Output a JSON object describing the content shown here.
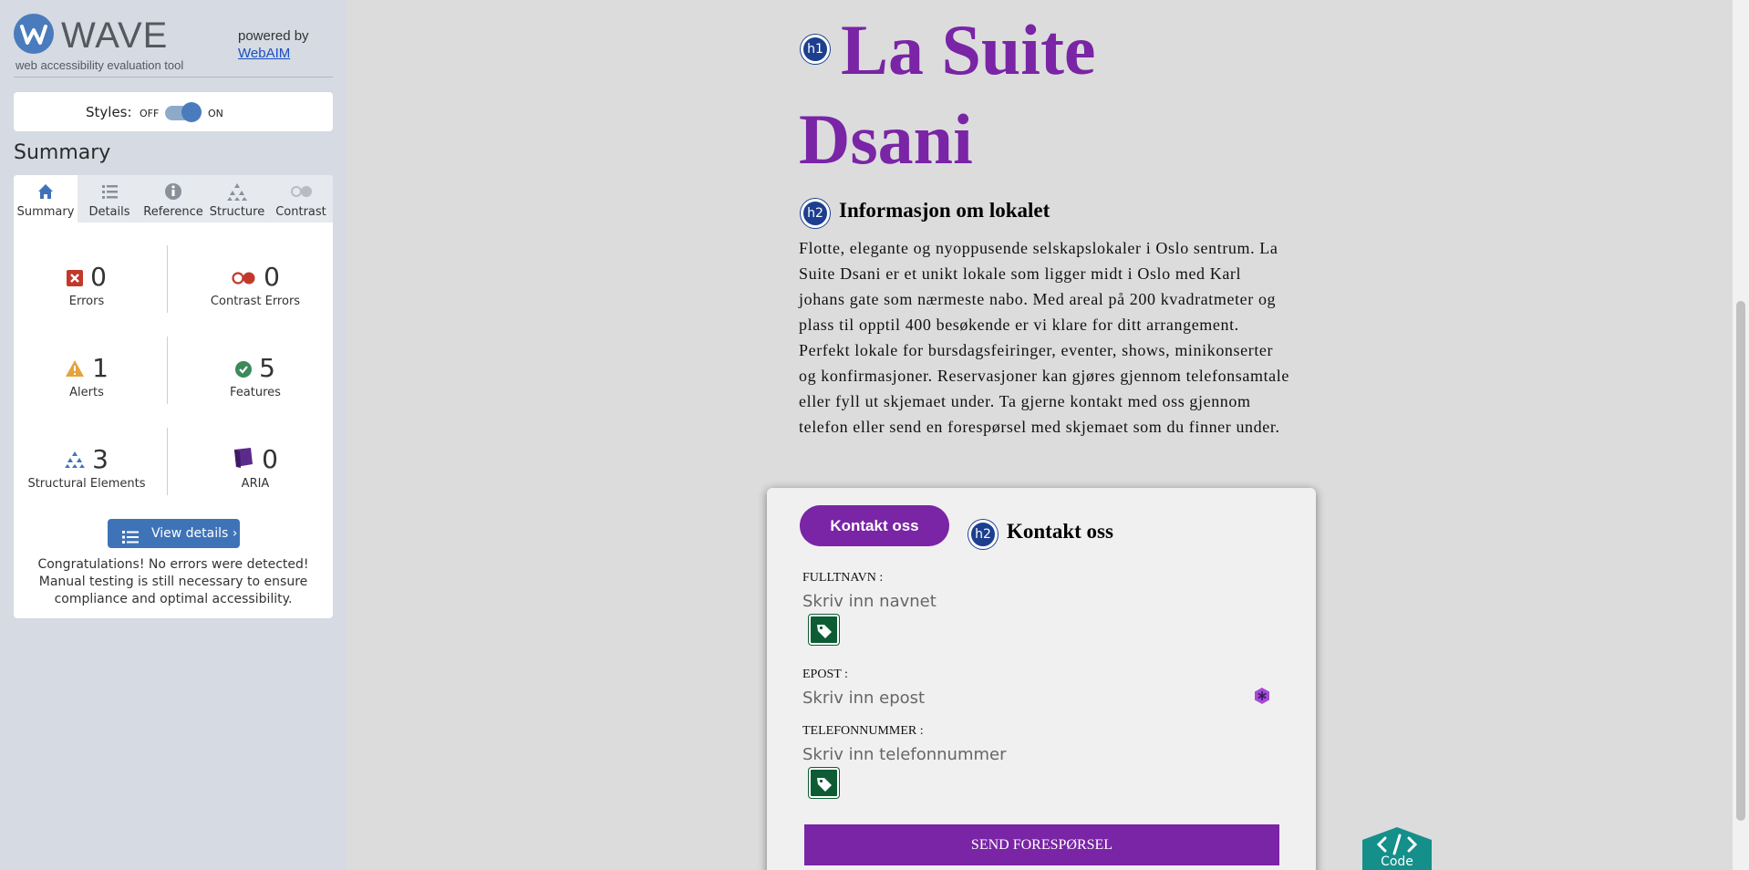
{
  "wave": {
    "brand": "WAVE",
    "tagline": "web accessibility evaluation tool",
    "powered_by": "powered by",
    "webaim_link": "WebAIM",
    "styles_label": "Styles:",
    "toggle_off": "OFF",
    "toggle_on": "ON",
    "summary_title": "Summary",
    "tabs": [
      {
        "label": "Summary",
        "icon": "home-icon",
        "active": true
      },
      {
        "label": "Details",
        "icon": "list-icon",
        "active": false
      },
      {
        "label": "Reference",
        "icon": "info-icon",
        "active": false
      },
      {
        "label": "Structure",
        "icon": "hierarchy-icon",
        "active": false
      },
      {
        "label": "Contrast",
        "icon": "contrast-icon",
        "active": false
      }
    ],
    "stats": {
      "errors": {
        "count": "0",
        "label": "Errors",
        "color": "#c0392b"
      },
      "contrast_errors": {
        "count": "0",
        "label": "Contrast Errors",
        "color": "#c0392b"
      },
      "alerts": {
        "count": "1",
        "label": "Alerts",
        "color": "#e6a23c"
      },
      "features": {
        "count": "5",
        "label": "Features",
        "color": "#3b8a5a"
      },
      "structural": {
        "count": "3",
        "label": "Structural Elements",
        "color": "#3f73b8"
      },
      "aria": {
        "count": "0",
        "label": "ARIA",
        "color": "#5b2b8c"
      }
    },
    "view_details": "View details ›",
    "congrats": "Congratulations! No errors were detected! Manual testing is still necessary to ensure compliance and optimal accessibility."
  },
  "page": {
    "h1_badge": "h1",
    "h1": "La Suite Dsani",
    "h2_badge": "h2",
    "h2": "Informasjon om lokalet",
    "paragraph": "Flotte, elegante og nyoppusende selskapslokaler i Oslo sentrum. La Suite Dsani er et unikt lokale som ligger midt i Oslo med Karl johans gate som nærmeste nabo. Med areal på 200 kvadratmeter og plass til opptil 400 besøkende er vi klare for ditt arrangement. Perfekt lokale for bursdagsfeiringer, eventer, shows, minikonserter og konfirmasjoner. Reservasjoner kan gjøres gjennom telefonsamtale eller fyll ut skjemaet under. Ta gjerne kontakt med oss gjennom telefon eller send en forespørsel med skjemaet som du finner under.",
    "form": {
      "kontakt_button": "Kontakt oss",
      "h2_badge": "h2",
      "h2": "Kontakt oss",
      "fields": [
        {
          "label": "FULLTNAVN :",
          "placeholder": "Skriv inn navnet"
        },
        {
          "label": "EPOST :",
          "placeholder": "Skriv inn epost"
        },
        {
          "label": "TELEFONNUMMER :",
          "placeholder": "Skriv inn telefonnummer"
        }
      ],
      "send_button": "SEND FORESPØRSEL"
    },
    "code_tab": "Code",
    "accent": "#7a24a6"
  }
}
